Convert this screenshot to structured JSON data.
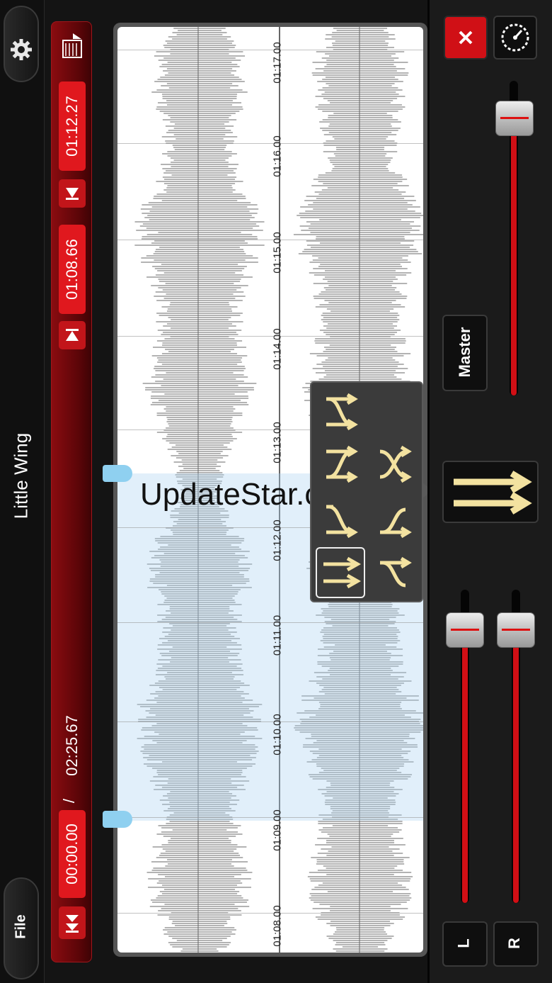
{
  "app": {
    "song_title": "Little Wing",
    "file_label": "File"
  },
  "transport": {
    "current_time": "00:00.00",
    "separator": "/",
    "total_time": "02:25.67",
    "loop_start": "01:08.66",
    "loop_end": "01:12.27"
  },
  "timeline": {
    "ticks": [
      "01:08.00",
      "01:09.00",
      "01:10.00",
      "01:11.00",
      "01:12.00",
      "01:13.00",
      "01:14.00",
      "01:15.00",
      "01:16.00",
      "01:17.00"
    ]
  },
  "watermark": "UpdateStar.com",
  "mixer": {
    "master_label": "Master",
    "left_label": "L",
    "right_label": "R",
    "master_level": 0.88,
    "left_level": 0.87,
    "right_level": 0.87
  },
  "colors": {
    "accent": "#d10f15",
    "marker": "#8fd0f0",
    "icon_cream": "#f3e2a0"
  },
  "icons": {
    "settings": "gear-icon",
    "close": "close-icon",
    "tempo": "speedometer-icon"
  }
}
